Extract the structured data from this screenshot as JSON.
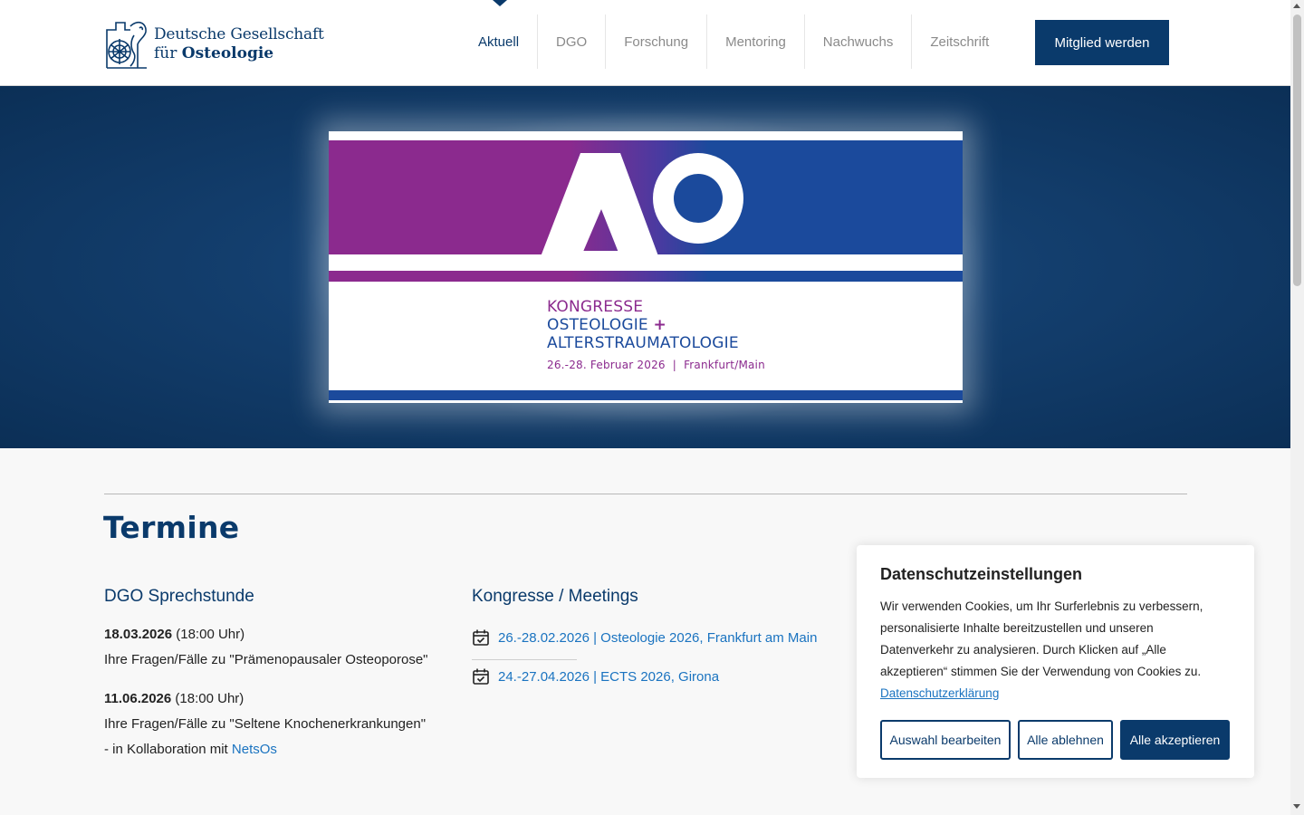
{
  "header": {
    "logo": {
      "line1": "Deutsche Gesellschaft",
      "line2_prefix": "für",
      "line2_bold": "Osteologie"
    },
    "nav": [
      {
        "label": "Aktuell",
        "active": true
      },
      {
        "label": "DGO"
      },
      {
        "label": "Forschung"
      },
      {
        "label": "Mentoring"
      },
      {
        "label": "Nachwuchs"
      },
      {
        "label": "Zeitschrift"
      }
    ],
    "cta_label": "Mitglied werden"
  },
  "hero": {
    "banner": {
      "logo_text": "AO",
      "line1": "KONGRESSE",
      "line2": "OSTEOLOGIE",
      "plus": "+",
      "line3": "ALTERSTRAUMATOLOGIE",
      "dates": "26.-28. Februar 2026",
      "separator": "|",
      "location": "Frankfurt/Main"
    }
  },
  "termine": {
    "title": "Termine",
    "sprechstunde": {
      "heading": "DGO Sprechstunde",
      "entries": [
        {
          "date": "18.03.2026",
          "time": "(18:00 Uhr)",
          "topic": "Ihre Fragen/Fälle zu \"Prämenopausaler Osteoporose\""
        },
        {
          "date": "11.06.2026",
          "time": "(18:00 Uhr)",
          "topic": "Ihre Fragen/Fälle zu \"Seltene Knochenerkrankungen\"",
          "extra_prefix": "- in Kollaboration mit",
          "extra_link": "NetsOs"
        }
      ]
    },
    "meetings": {
      "heading": "Kongresse / Meetings",
      "items": [
        {
          "label": "26.-28.02.2026 | Osteologie 2026, Frankfurt am Main"
        },
        {
          "label": "24.-27.04.2026 | ECTS 2026, Girona"
        }
      ]
    }
  },
  "cookie": {
    "title": "Datenschutzeinstellungen",
    "text": "Wir verwenden Cookies, um Ihr Surferlebnis zu verbessern, personalisierte Inhalte bereitzustellen und unseren Datenverkehr zu analysieren. Durch Klicken auf „Alle akzeptieren“ stimmen Sie der Verwendung von Cookies zu.",
    "link": "Datenschutzerklärung",
    "buttons": {
      "edit": "Auswahl bearbeiten",
      "reject": "Alle ablehnen",
      "accept": "Alle akzeptieren"
    }
  },
  "colors": {
    "primary": "#0a3a6b",
    "link": "#1a73c0",
    "purple": "#8b2a8e",
    "banner_blue": "#1b4a9c"
  },
  "icons": {
    "logo": "osteology-emblem-icon",
    "calendar": "calendar-check-icon"
  }
}
